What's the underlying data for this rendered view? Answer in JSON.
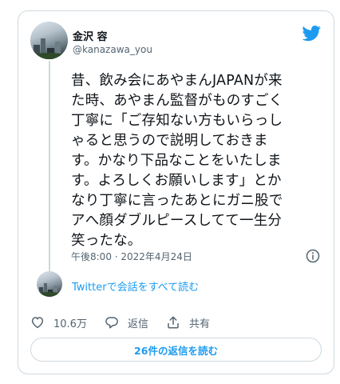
{
  "tweet": {
    "author_name": "金沢 容",
    "author_handle": "@kanazawa_you",
    "text": "昔、飲み会にあやまんJAPANが来\nた時、あやまん監督がものすごく\n丁寧に「ご存知ない方もいらっし\nゃると思うので説明しておきま\nす。かなり下品なことをいたしま\nす。よろしくお願いします」とか\nなり丁寧に言ったあとにガニ股で\nアへ顔ダブルピースしてて一生分\n笑ったな。",
    "timestamp": "午後8:00 · 2022年4月24日",
    "conversation_link": "Twitterで会話をすべて読む"
  },
  "actions": {
    "like_count": "10.6万",
    "reply_label": "返信",
    "share_label": "共有"
  },
  "read_replies_button": "26件の返信を読む",
  "icons": {
    "logo": "twitter-bird-icon",
    "info": "info-icon",
    "like": "heart-icon",
    "reply": "reply-bubble-icon",
    "share": "share-icon"
  },
  "colors": {
    "accent": "#1d9bf0",
    "text_primary": "#0f1419",
    "text_secondary": "#536471",
    "border": "#cfd9de"
  }
}
